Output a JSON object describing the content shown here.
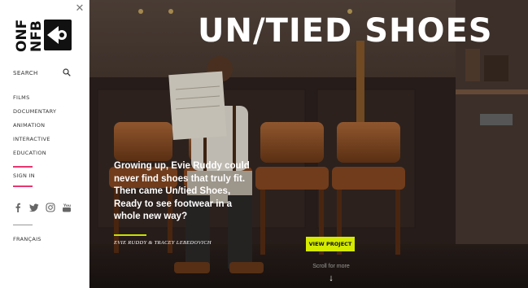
{
  "sidebar": {
    "logo_lines": [
      "ONF",
      "NFB"
    ],
    "search_label": "SEARCH",
    "nav": [
      {
        "label": "FILMS"
      },
      {
        "label": "DOCUMENTARY"
      },
      {
        "label": "ANIMATION"
      },
      {
        "label": "INTERACTIVE"
      },
      {
        "label": "EDUCATION"
      }
    ],
    "signin_label": "SIGN IN",
    "language_label": "FRANÇAIS",
    "social": [
      "facebook-icon",
      "twitter-icon",
      "instagram-icon",
      "youtube-icon"
    ],
    "accent_color": "#e8366f"
  },
  "hero": {
    "title": "UN/TIED SHOES",
    "copy": "Growing up, Evie Ruddy could never find shoes that truly fit. Then came Un/tied Shoes, Ready to see footwear in a whole new way?",
    "credits": "EVIE RUDDY & TRACEY LEBEDOVICH",
    "button_label": "VIEW PROJECT",
    "scroll_label": "Scroll for more",
    "button_color": "#d4ea00"
  }
}
